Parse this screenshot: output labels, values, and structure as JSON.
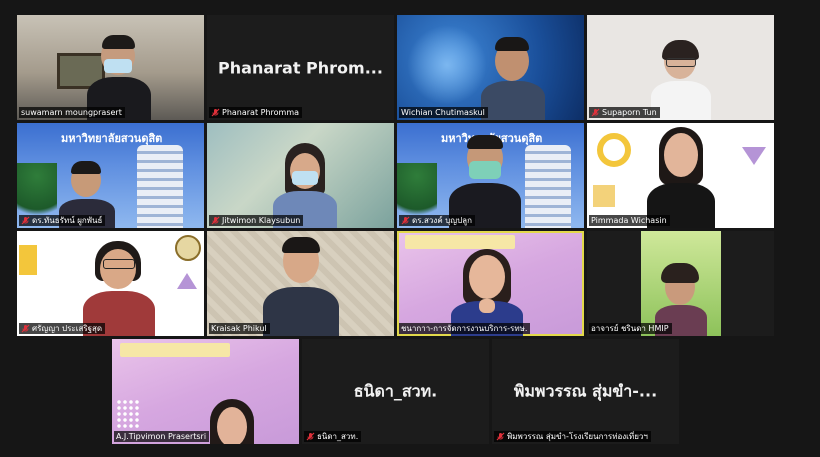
{
  "participants": [
    {
      "id": "p1",
      "name": "suwamarn moungprasert",
      "muted": false,
      "video": true
    },
    {
      "id": "p2",
      "name": "Phanarat Phromma",
      "display_name": "Phanarat  Phrom...",
      "muted": true,
      "video": false
    },
    {
      "id": "p3",
      "name": "Wichian Chutimaskul",
      "muted": false,
      "video": true
    },
    {
      "id": "p4",
      "name": "Supaporn Tun",
      "muted": true,
      "video": true
    },
    {
      "id": "p5",
      "name": "ดร.ทันธรัทน์ ผูกพันธ์",
      "muted": true,
      "video": true,
      "banner": "มหาวิทยาลัยสวนดุสิต"
    },
    {
      "id": "p6",
      "name": "Jitwimon Klaysubun",
      "muted": true,
      "video": true
    },
    {
      "id": "p7",
      "name": "ดร.สวงค์ บุญปลูก",
      "muted": true,
      "video": true,
      "banner": "มหาวิทยาลัยสวนดุสิต"
    },
    {
      "id": "p8",
      "name": "Pimmada Wichasin",
      "muted": false,
      "video": true
    },
    {
      "id": "p9",
      "name": "ศรัญญา ประเสริฐสุด",
      "muted": true,
      "video": true
    },
    {
      "id": "p10",
      "name": "Kraisak Phikul",
      "muted": false,
      "video": true
    },
    {
      "id": "p11",
      "name": "ชนากาา-การจัดการงานบริการ-รทษ.",
      "muted": false,
      "video": true,
      "active": true
    },
    {
      "id": "p12",
      "name": "อาจารย์ ชรินดา HMIP",
      "muted": false,
      "video": true
    },
    {
      "id": "p13",
      "name": "A.J.Tipvimon Prasertsri",
      "muted": false,
      "video": true
    },
    {
      "id": "p14",
      "name": "ธนิดา_สวท.",
      "display_name": "ธนิดา_สวท.",
      "muted": true,
      "video": false
    },
    {
      "id": "p15",
      "name": "พิมพวรรณ สุ่มขำ-โรงเรียนการท่องเที่ยวฯ",
      "display_name": "พิมพวรรณ สุ่มขำ-...",
      "muted": true,
      "video": false
    }
  ],
  "colors": {
    "stage": "#161616",
    "active_border": "#e2d94b",
    "mute_icon": "#e0303a",
    "label_bg": "rgba(0,0,0,0.72)"
  }
}
